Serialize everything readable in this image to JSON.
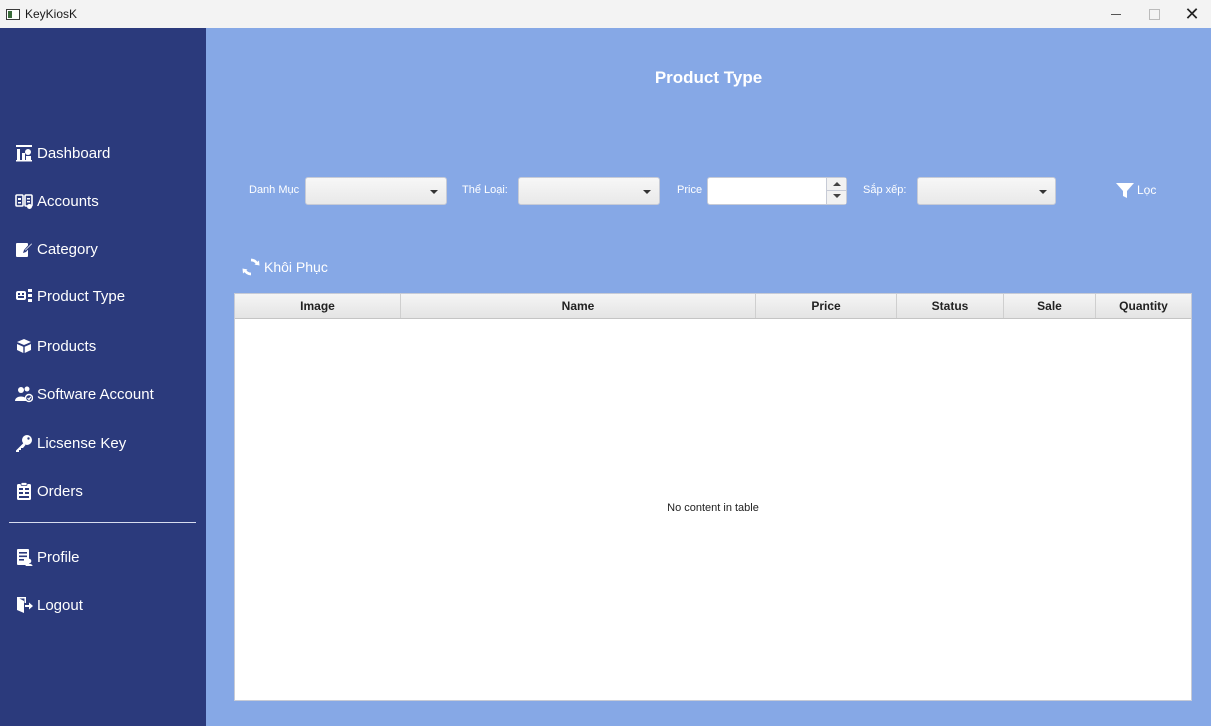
{
  "window": {
    "title": "KeyKiosK",
    "minimize_icon": "minimize-icon",
    "maximize_icon": "maximize-icon",
    "close_icon": "close-icon",
    "close_glyph": "✕"
  },
  "sidebar": {
    "items": [
      {
        "label": "Dashboard",
        "icon": "dashboard-icon"
      },
      {
        "label": "Accounts",
        "icon": "accounts-icon"
      },
      {
        "label": "Category",
        "icon": "edit-icon"
      },
      {
        "label": "Product Type",
        "icon": "product-type-icon"
      },
      {
        "label": "Products",
        "icon": "products-icon"
      },
      {
        "label": "Software Account",
        "icon": "users-icon"
      },
      {
        "label": "Licsense Key",
        "icon": "key-icon"
      },
      {
        "label": "Orders",
        "icon": "clipboard-icon"
      }
    ],
    "bottom_items": [
      {
        "label": "Profile",
        "icon": "profile-icon"
      },
      {
        "label": "Logout",
        "icon": "logout-icon"
      }
    ]
  },
  "page": {
    "title": "Product Type"
  },
  "filters": {
    "category_label": "Danh Mục",
    "category_value": "",
    "genre_label": "Thể Loại:",
    "genre_value": "",
    "price_label": "Price",
    "price_value": "",
    "sort_label": "Sắp xếp:",
    "sort_value": "",
    "filter_button": "Lọc"
  },
  "restore_button": "Khôi Phục",
  "table": {
    "columns": [
      "Image",
      "Name",
      "Price",
      "Status",
      "Sale",
      "Quantity"
    ],
    "rows": [],
    "empty_message": "No content in table"
  },
  "colors": {
    "sidebar": "#2b3a7c",
    "main": "#86a8e6",
    "titlebar": "#f3f3f3"
  }
}
